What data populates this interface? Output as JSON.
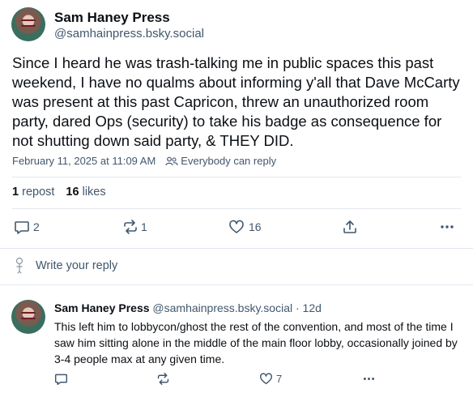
{
  "post": {
    "author_name": "Sam Haney Press",
    "author_handle": "@samhainpress.bsky.social",
    "text": "Since I heard he was trash-talking me in public spaces this past weekend, I have no qualms about informing y'all that Dave McCarty was present at this past Capricon, threw an unauthorized room party, dared Ops (security) to take his badge as consequence for not shutting down said party, & THEY DID.",
    "timestamp": "February 11, 2025 at 11:09 AM",
    "reply_setting": "Everybody can reply",
    "reposts_count": "1",
    "reposts_label": "repost",
    "likes_count": "16",
    "likes_label": "likes",
    "actions": {
      "reply_count": "2",
      "repost_count": "1",
      "like_count": "16"
    }
  },
  "reply_prompt": "Write your reply",
  "comment": {
    "author_name": "Sam Haney Press",
    "author_handle": "@samhainpress.bsky.social",
    "age": "· 12d",
    "text": "This left him to lobbycon/ghost the rest of the convention, and most of the time I saw him sitting alone in the middle of the main floor lobby, occasionally joined by 3-4 people max at any given time.",
    "like_count": "7"
  },
  "colors": {
    "text": "#0b0f14",
    "muted": "#42576c",
    "divider": "#e2e7ee"
  }
}
